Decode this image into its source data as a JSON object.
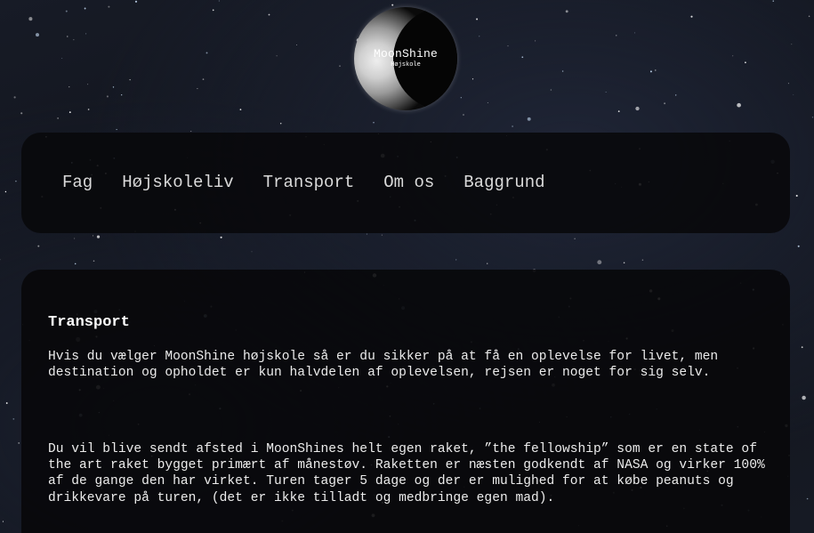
{
  "logo": {
    "title": "MoonShine",
    "subtitle": "Højskole"
  },
  "nav": {
    "items": [
      {
        "label": "Fag"
      },
      {
        "label": "Højskoleliv"
      },
      {
        "label": "Transport"
      },
      {
        "label": "Om os"
      },
      {
        "label": "Baggrund"
      }
    ]
  },
  "content": {
    "title": "Transport",
    "paragraphs": [
      "Hvis du vælger MoonShine højskole så er du sikker på at få en oplevelse for livet, men destination og opholdet er kun halvdelen af oplevelsen, rejsen er noget for sig selv.",
      "Du vil blive sendt afsted i MoonShines helt egen raket, ”the fellowship” som er en state of the art raket bygget primært af månestøv. Raketten er næsten godkendt af NASA og virker 100% af de gange den har virket. Turen tager 5 dage og der er mulighed for at købe peanuts og drikkevare på turen, (det er ikke tilladt og medbringe egen mad)."
    ]
  },
  "colors": {
    "panel": "#08080a",
    "text": "#ececec",
    "sky": "#141824"
  }
}
